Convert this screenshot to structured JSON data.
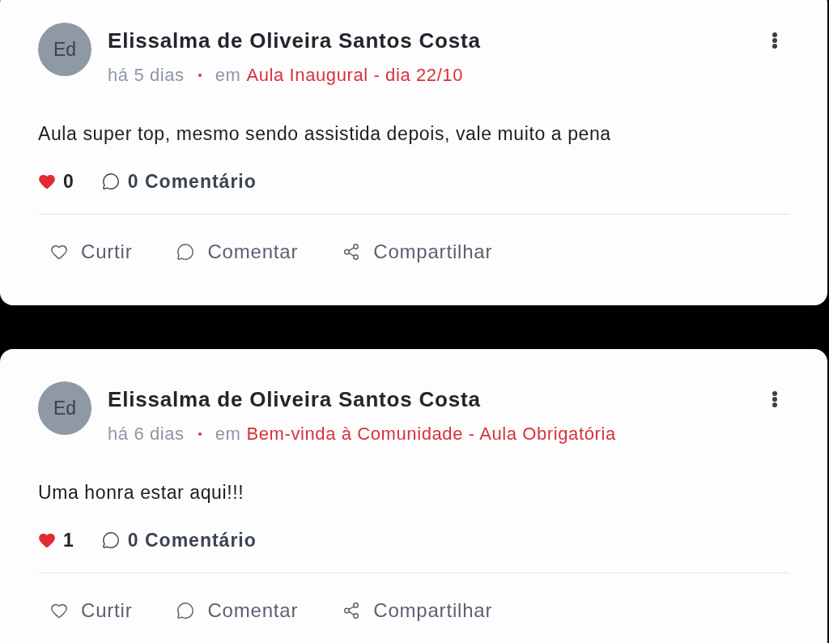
{
  "posts": [
    {
      "author": {
        "initials": "Ed",
        "name": "Elissalma de Oliveira Santos Costa"
      },
      "time": "há 5 dias",
      "location_prefix": "em",
      "location": "Aula Inaugural - dia 22/10",
      "body": "Aula super top, mesmo sendo assistida depois, vale muito a pena",
      "likes": "0",
      "comments": "0 Comentário",
      "liked": false,
      "actions": [
        {
          "kind": "like",
          "label": "Curtir"
        },
        {
          "kind": "comment",
          "label": "Comentar"
        },
        {
          "kind": "share",
          "label": "Compartilhar"
        }
      ]
    },
    {
      "author": {
        "initials": "Ed",
        "name": "Elissalma de Oliveira Santos Costa"
      },
      "time": "há 6 dias",
      "location_prefix": "em",
      "location": "Bem-vinda à Comunidade - Aula Obrigatória",
      "body": "Uma honra estar aqui!!!",
      "likes": "1",
      "comments": "0 Comentário",
      "liked": false,
      "actions": [
        {
          "kind": "like",
          "label": "Curtir"
        },
        {
          "kind": "comment",
          "label": "Comentar"
        },
        {
          "kind": "share",
          "label": "Compartilhar"
        }
      ]
    }
  ]
}
